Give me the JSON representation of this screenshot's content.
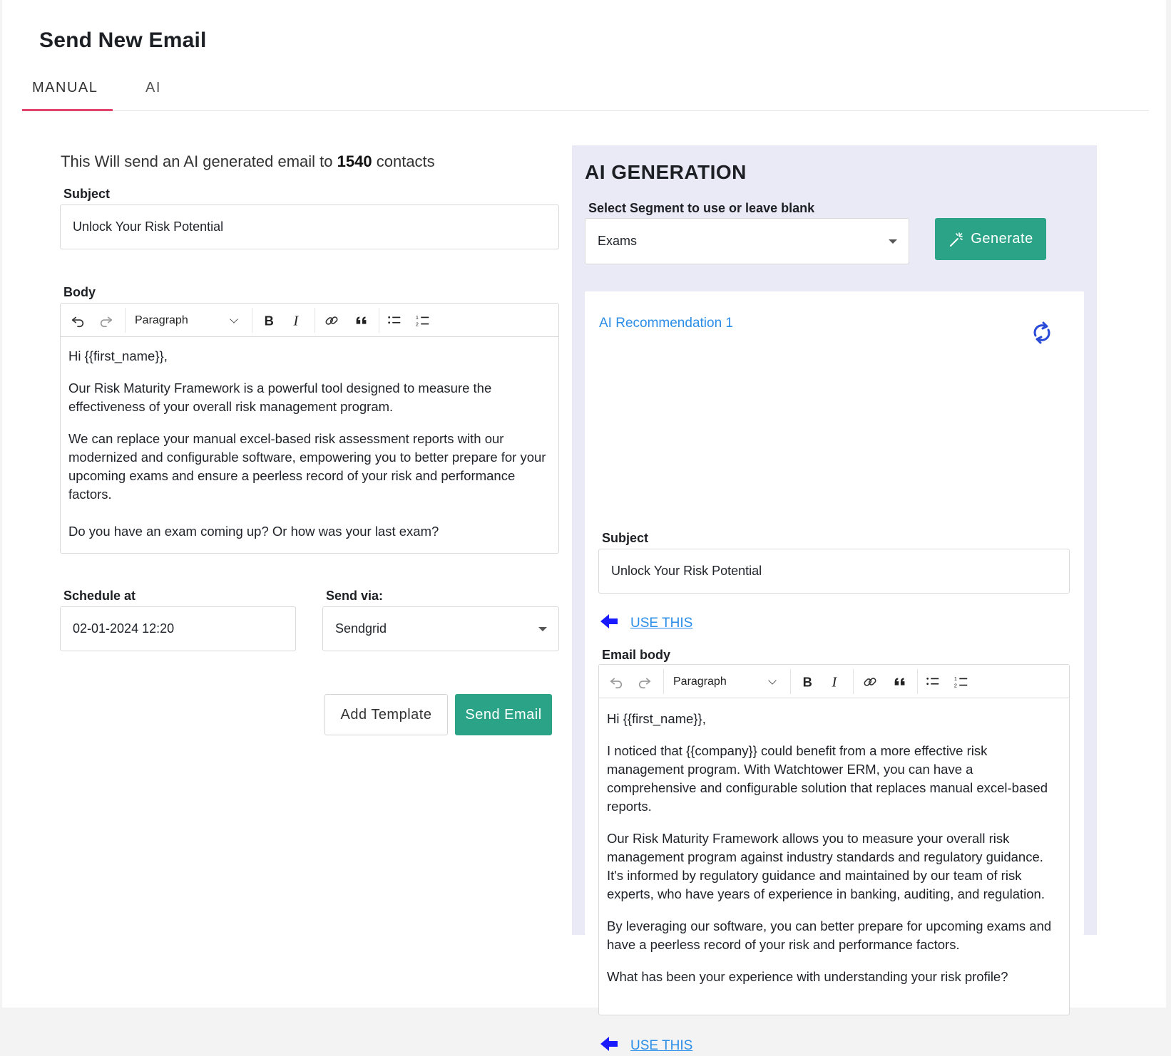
{
  "page": {
    "title": "Send New Email"
  },
  "tabs": [
    {
      "label": "MANUAL",
      "active": true
    },
    {
      "label": "AI",
      "active": false
    }
  ],
  "manual": {
    "info_prefix": "This Will send an AI generated email to",
    "contact_count": "1540",
    "info_suffix": "contacts",
    "subject_label": "Subject",
    "subject_value": "Unlock Your Risk Potential",
    "body_label": "Body",
    "toolbar": {
      "paragraph": "Paragraph"
    },
    "body_paragraphs": [
      "Hi {{first_name}},",
      "Our Risk Maturity Framework is a powerful tool designed to measure the effectiveness of your overall risk management program.",
      "We can replace your manual excel-based risk assessment reports with our modernized and configurable software, empowering you to better prepare for your upcoming exams and ensure a peerless record of your risk and performance factors.",
      "Do you have an exam coming up? Or how was your last exam?"
    ],
    "schedule_label": "Schedule at",
    "schedule_value": "02-01-2024 12:20",
    "send_via_label": "Send via:",
    "send_via_value": "Sendgrid",
    "add_template_label": "Add Template",
    "send_email_label": "Send Email"
  },
  "ai_panel": {
    "title": "AI GENERATION",
    "segment_label": "Select Segment to use or leave blank",
    "segment_value": "Exams",
    "generate_label": "Generate",
    "recommendation_title": "AI Recommendation 1",
    "subject_label": "Subject",
    "subject_value": "Unlock Your Risk Potential",
    "use_this_label": "USE THIS",
    "email_body_label": "Email body",
    "toolbar": {
      "paragraph": "Paragraph"
    },
    "body_paragraphs": [
      "Hi {{first_name}},",
      "I noticed that {{company}} could benefit from a more effective risk management program. With Watchtower ERM, you can have a comprehensive and configurable solution that replaces manual excel-based reports.",
      "Our Risk Maturity Framework allows you to measure your overall risk management program against industry standards and regulatory guidance. It's informed by regulatory guidance and maintained by our team of risk experts, who have years of experience in banking, auditing, and regulation.",
      "By leveraging our software, you can better prepare for upcoming exams and have a peerless record of your risk and performance factors.",
      "What has been your experience with understanding your risk profile?"
    ]
  },
  "colors": {
    "accent": "#2aa386",
    "link": "#2a8de8",
    "tab_underline": "#e0446a",
    "panel_bg": "#e9eaf5",
    "arrow": "#1a1aff"
  }
}
